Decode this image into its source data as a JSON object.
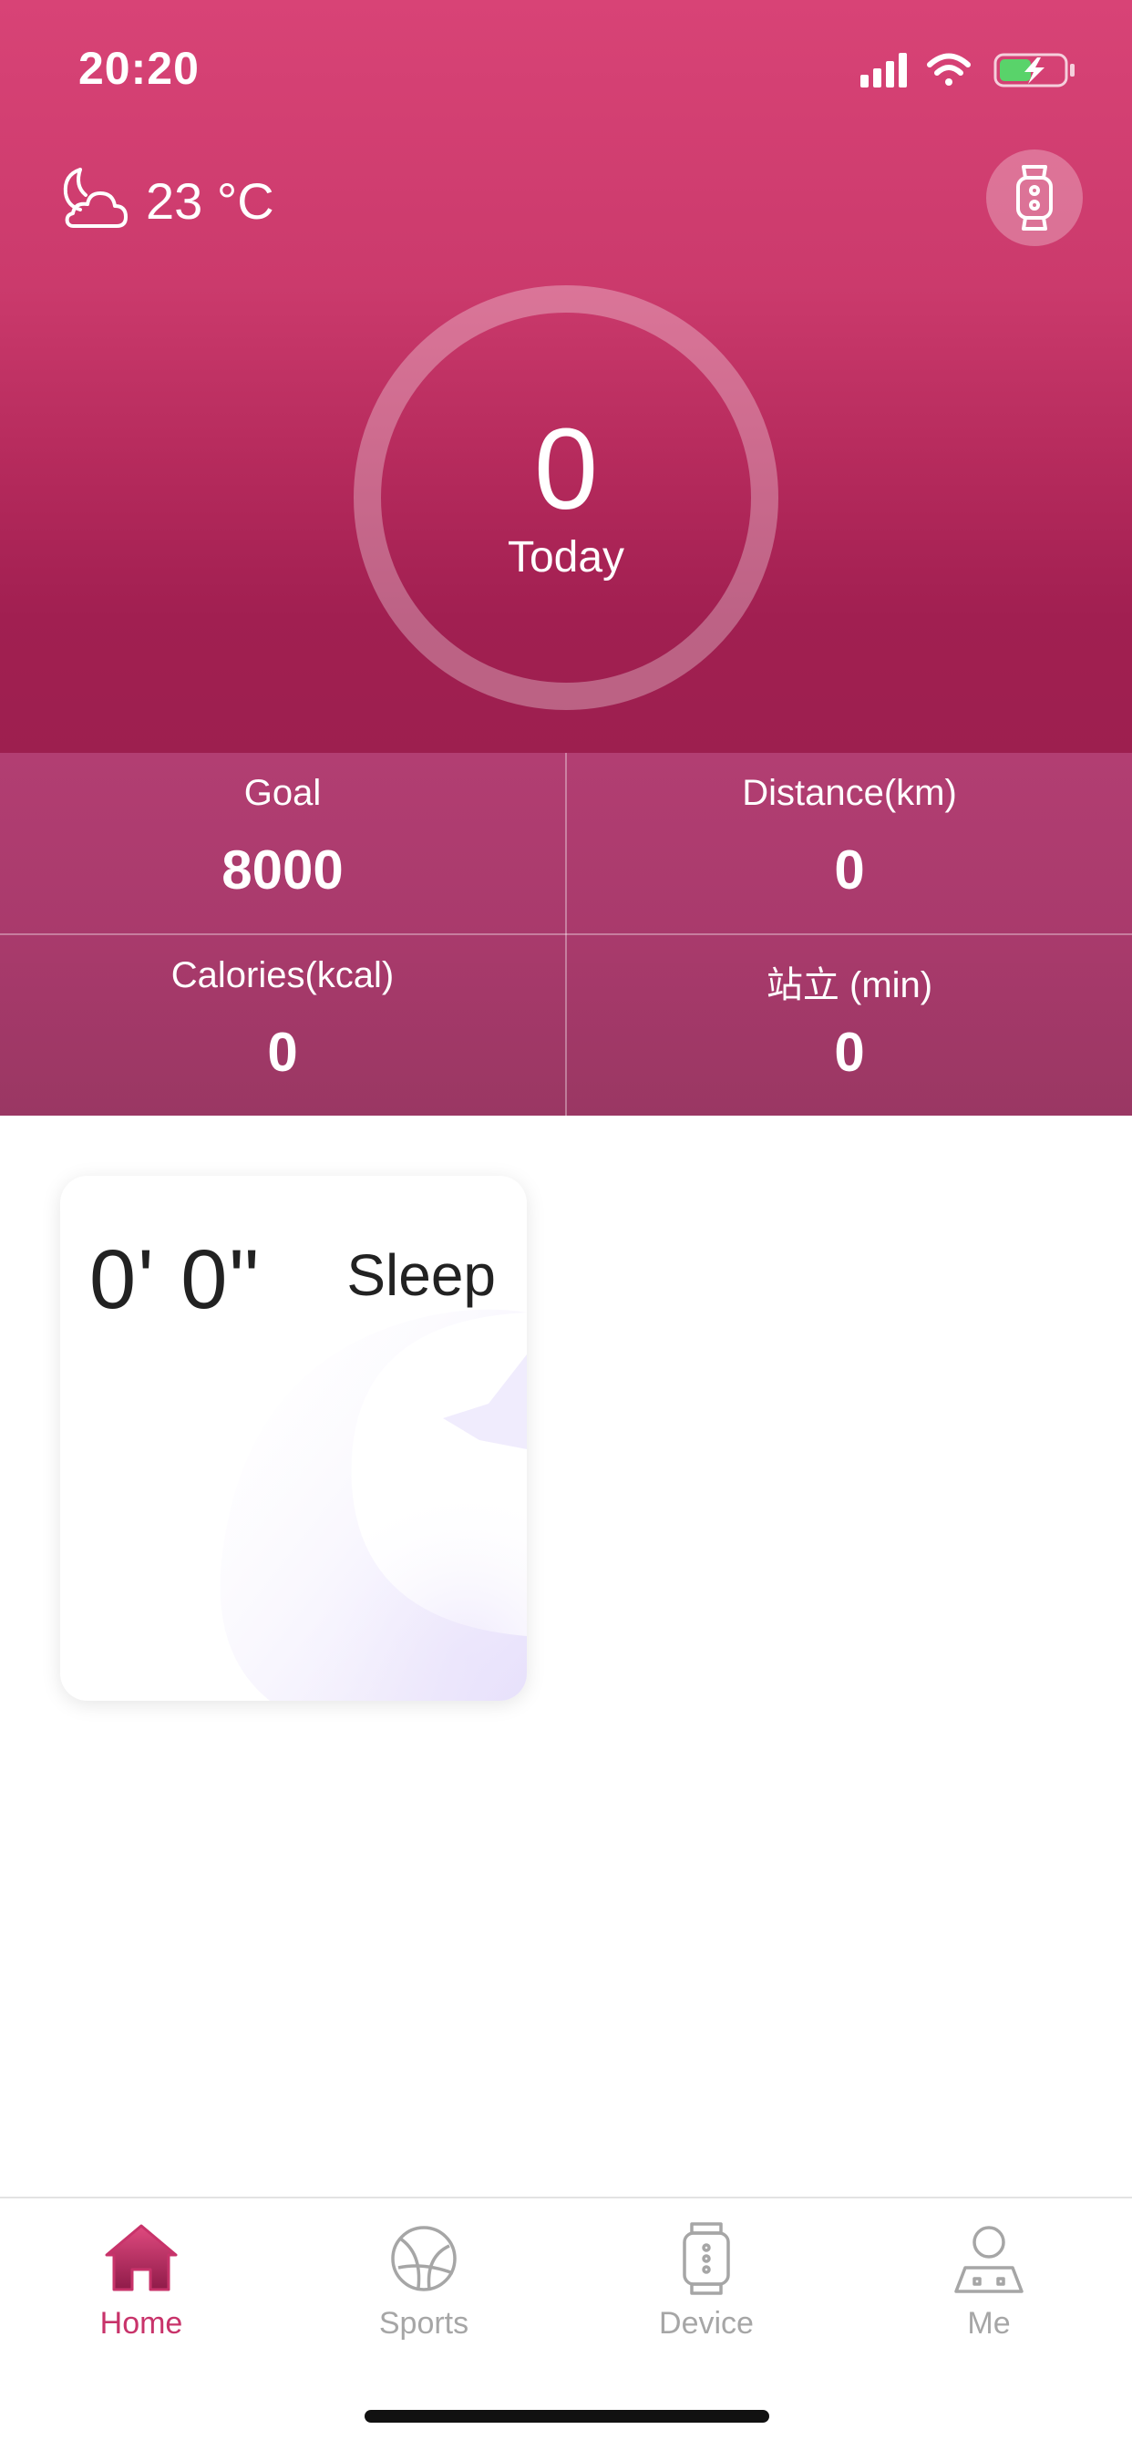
{
  "status_bar": {
    "time": "20:20",
    "icons": [
      "signal-icon",
      "wifi-icon",
      "battery-charging-icon"
    ]
  },
  "weather": {
    "icon": "moon-cloud-icon",
    "temperature": "23 °C"
  },
  "band_button": {
    "icon": "band-icon"
  },
  "steps": {
    "count": "0",
    "label": "Today",
    "goal_progress_fraction": 0
  },
  "stats": [
    {
      "label": "Goal",
      "value": "8000"
    },
    {
      "label": "Distance(km)",
      "value": "0"
    },
    {
      "label": "Calories(kcal)",
      "value": "0"
    },
    {
      "label": "站立 (min)",
      "value": "0"
    }
  ],
  "sleep_card": {
    "duration": "0' 0\"",
    "label": "Sleep"
  },
  "tab_bar": {
    "tabs": [
      {
        "label": "Home",
        "icon": "home-icon",
        "active": true
      },
      {
        "label": "Sports",
        "icon": "ball-icon",
        "active": false
      },
      {
        "label": "Device",
        "icon": "watch-icon",
        "active": false
      },
      {
        "label": "Me",
        "icon": "user-icon",
        "active": false
      }
    ]
  },
  "colors": {
    "header_top": "#d84376",
    "header_bottom": "#9d1f4f",
    "accent": "#c8336a",
    "tab_inactive": "#a6a6a6"
  }
}
